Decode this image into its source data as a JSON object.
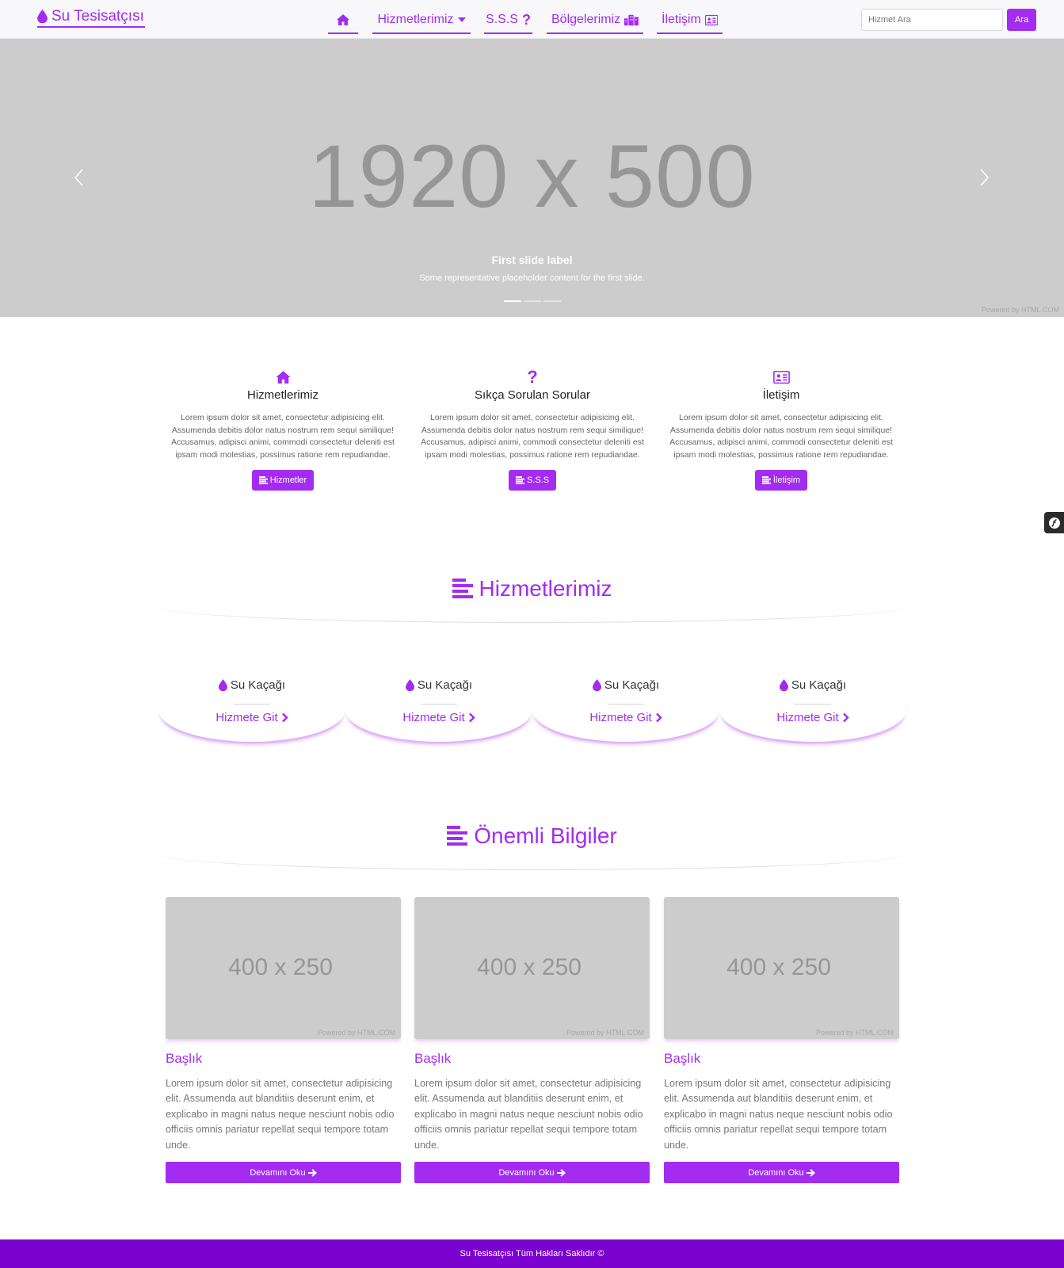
{
  "navbar": {
    "brand": "Su Tesisatçısı",
    "items": [
      {
        "label": ""
      },
      {
        "label": "Hizmetlerimiz"
      },
      {
        "label": "S.S.S"
      },
      {
        "label": "Bölgelerimiz"
      },
      {
        "label": "İletişim"
      }
    ],
    "search_placeholder": "Hizmet Ara",
    "search_button": "Ara"
  },
  "carousel": {
    "image_text": "1920 x 500",
    "caption_title": "First slide label",
    "caption_text": "Some representative placeholder content for the first slide.",
    "slide_count": 3,
    "active_slide": 1,
    "powered_by": "Powered by HTML.COM"
  },
  "features": [
    {
      "icon": "home-icon",
      "title": "Hizmetlerimiz",
      "text": "Lorem ipsum dolor sit amet, consectetur adipisicing elit. Assumenda debitis dolor natus nostrum rem sequi similique! Accusamus, adipisci animi, commodi consectetur deleniti est ipsam modi molestias, possimus ratione rem repudiandae.",
      "button": "Hizmetler"
    },
    {
      "icon": "question-icon",
      "title": "Sıkça Sorulan Sorular",
      "text": "Lorem ipsum dolor sit amet, consectetur adipisicing elit. Assumenda debitis dolor natus nostrum rem sequi similique! Accusamus, adipisci animi, commodi consectetur deleniti est ipsam modi molestias, possimus ratione rem repudiandae.",
      "button": "S.S.S"
    },
    {
      "icon": "contact-card-icon",
      "title": "İletişim",
      "text": "Lorem ipsum dolor sit amet, consectetur adipisicing elit. Assumenda debitis dolor natus nostrum rem sequi similique! Accusamus, adipisci animi, commodi consectetur deleniti est ipsam modi molestias, possimus ratione rem repudiandae.",
      "button": "İletişim"
    }
  ],
  "services_section": {
    "title": "Hizmetlerimiz",
    "items": [
      {
        "title": "Su Kaçağı",
        "link": "Hizmete Git"
      },
      {
        "title": "Su Kaçağı",
        "link": "Hizmete Git"
      },
      {
        "title": "Su Kaçağı",
        "link": "Hizmete Git"
      },
      {
        "title": "Su Kaçağı",
        "link": "Hizmete Git"
      }
    ]
  },
  "info_section": {
    "title": "Önemli Bilgiler",
    "cards": [
      {
        "image_text": "400 x 250",
        "powered_by": "Powered by HTML.COM",
        "title": "Başlık",
        "text": "Lorem ipsum dolor sit amet, consectetur adipisicing elit. Assumenda aut blanditiis deserunt enim, et explicabo in magni natus neque nesciunt nobis odio officiis omnis pariatur repellat sequi tempore totam unde.",
        "button": "Devamını Oku"
      },
      {
        "image_text": "400 x 250",
        "powered_by": "Powered by HTML.COM",
        "title": "Başlık",
        "text": "Lorem ipsum dolor sit amet, consectetur adipisicing elit. Assumenda aut blanditiis deserunt enim, et explicabo in magni natus neque nesciunt nobis odio officiis omnis pariatur repellat sequi tempore totam unde.",
        "button": "Devamını Oku"
      },
      {
        "image_text": "400 x 250",
        "powered_by": "Powered by HTML.COM",
        "title": "Başlık",
        "text": "Lorem ipsum dolor sit amet, consectetur adipisicing elit. Assumenda aut blanditiis deserunt enim, et explicabo in magni natus neque nesciunt nobis odio officiis omnis pariatur repellat sequi tempore totam unde.",
        "button": "Devamını Oku"
      }
    ]
  },
  "footer": {
    "text": "Su Tesisatçısı Tüm Hakları Saklıdır ©"
  },
  "colors": {
    "accent": "#a32cf0",
    "footer": "#7b03d0",
    "placeholder": "#cccccc"
  }
}
